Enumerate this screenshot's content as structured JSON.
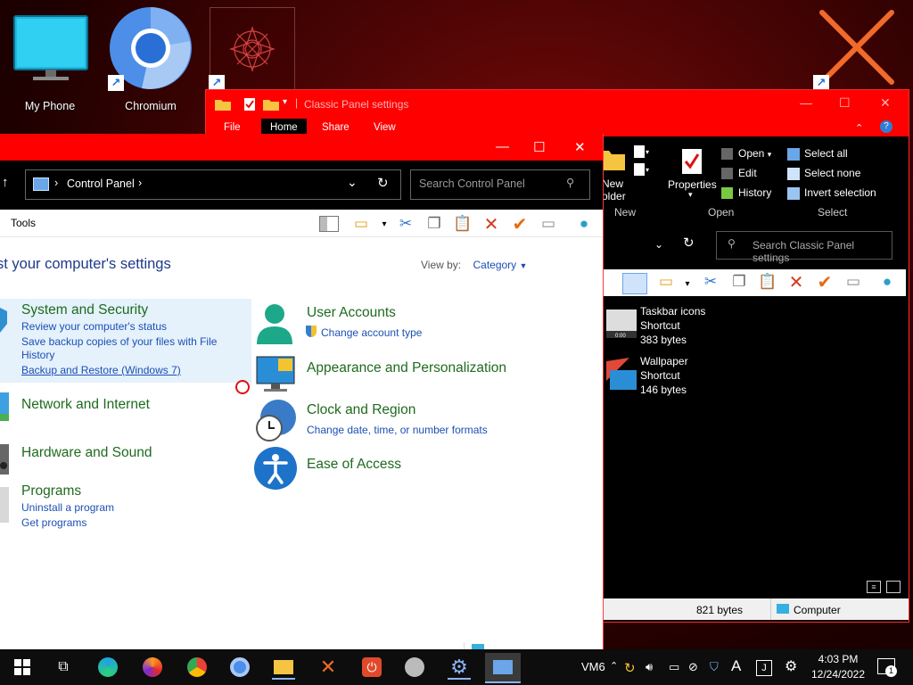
{
  "desktop": {
    "icons": [
      {
        "label": "My Phone"
      },
      {
        "label": "Chromium"
      }
    ]
  },
  "explorer": {
    "title": "Classic Panel settings",
    "tabs": [
      "File",
      "Home",
      "Share",
      "View"
    ],
    "ribbon": {
      "new_folder": "New\nfolder",
      "new_group": "New",
      "properties": "Properties",
      "open": "Open",
      "edit": "Edit",
      "history": "History",
      "open_group": "Open",
      "select_all": "Select all",
      "select_none": "Select none",
      "invert_selection": "Invert selection",
      "select_group": "Select"
    },
    "search_placeholder": "Search Classic Panel settings",
    "files": [
      {
        "name": "Taskbar icons",
        "type": "Shortcut",
        "size": "383 bytes"
      },
      {
        "name": "Wallpaper",
        "type": "Shortcut",
        "size": "146 bytes"
      }
    ],
    "status": {
      "size": "821 bytes",
      "location": "Computer"
    }
  },
  "control_panel": {
    "address": "Control Panel",
    "search_placeholder": "Search Control Panel",
    "menu_tools": "Tools",
    "heading": "st your computer's settings",
    "view_by_label": "View by:",
    "view_by_value": "Category",
    "left": [
      {
        "title": "System and Security",
        "links": [
          "Review your computer's status",
          "Save backup copies of your files with File",
          "History",
          "Backup and Restore (Windows 7)"
        ]
      },
      {
        "title": "Network and Internet",
        "links": []
      },
      {
        "title": "Hardware and Sound",
        "links": []
      },
      {
        "title": "Programs",
        "links": [
          "Uninstall a program",
          "Get programs"
        ]
      }
    ],
    "right": [
      {
        "title": "User Accounts",
        "links": [
          "Change account type"
        ]
      },
      {
        "title": "Appearance and Personalization",
        "links": []
      },
      {
        "title": "Clock and Region",
        "links": [
          "Change date, time, or number formats"
        ]
      },
      {
        "title": "Ease of Access",
        "links": []
      }
    ]
  },
  "taskbar": {
    "vm_label": "VM6",
    "time": "4:03 PM",
    "date": "12/24/2022",
    "notification_count": "1",
    "input_indicator": "A"
  }
}
